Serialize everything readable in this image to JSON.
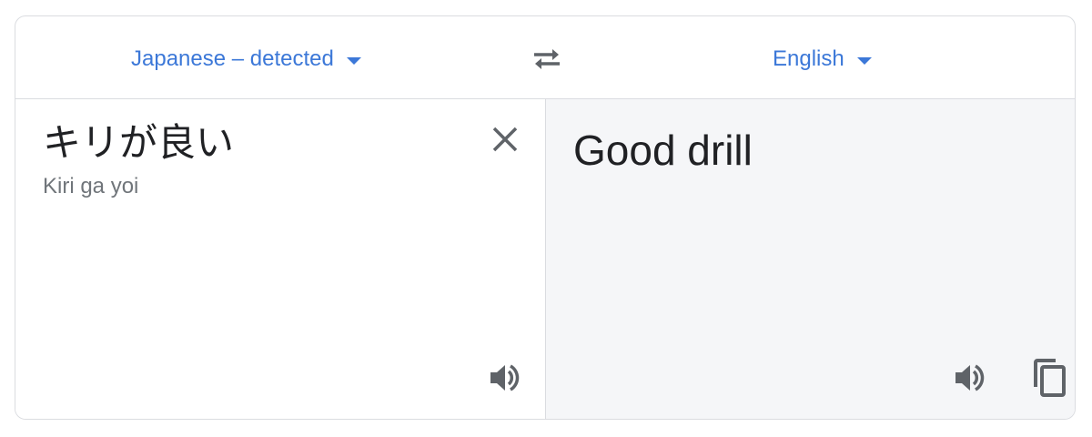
{
  "languages": {
    "source_label": "Japanese – detected",
    "target_label": "English"
  },
  "source": {
    "text": "キリが良い",
    "romanization": "Kiri ga yoi"
  },
  "target": {
    "text": "Good drill"
  },
  "icons": {
    "swap": "swap-arrows-icon",
    "clear": "close-icon",
    "listen": "speaker-icon",
    "copy": "copy-icon"
  },
  "colors": {
    "accent": "#3c78d8",
    "icon": "#5f6368",
    "target_bg": "#f5f6f8",
    "border": "#dadce0"
  }
}
